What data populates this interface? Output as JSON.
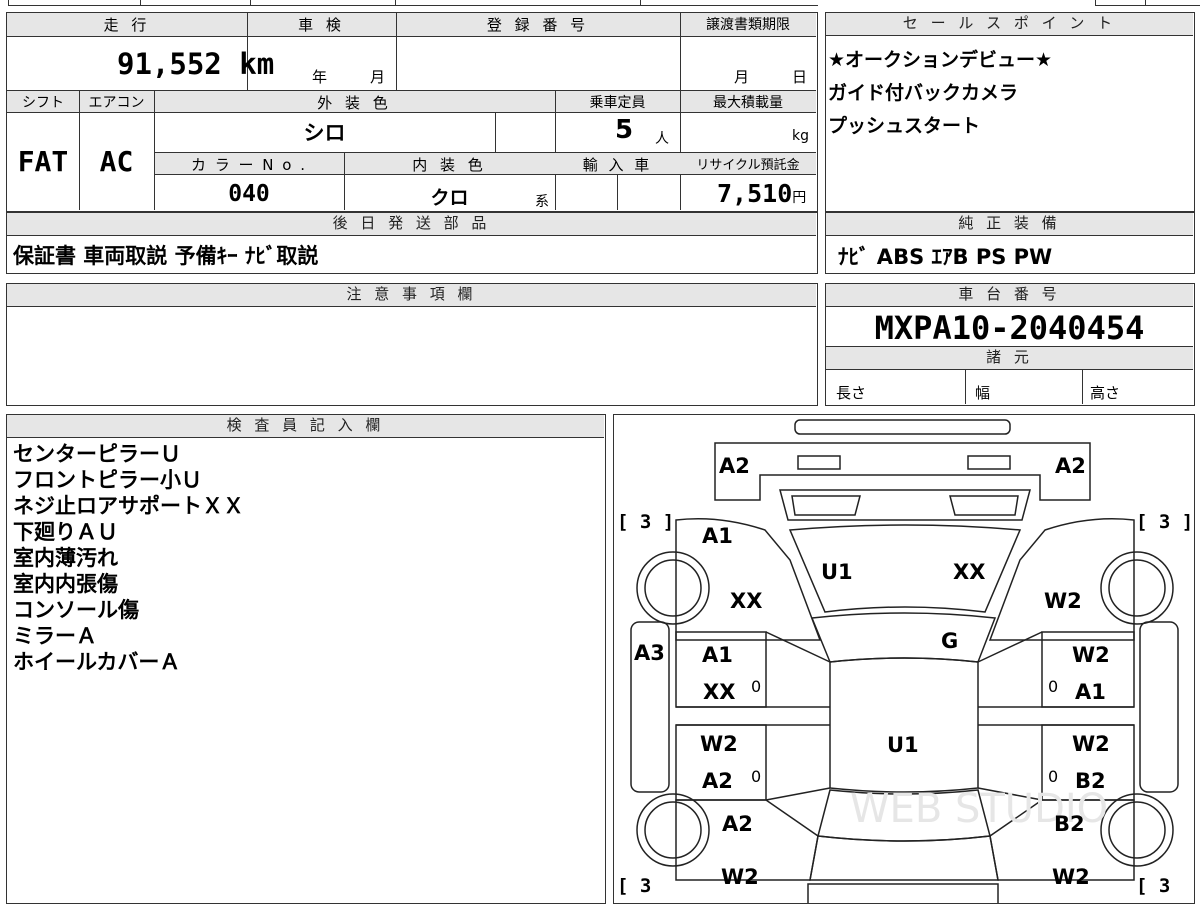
{
  "vehicle": {
    "mileage_header": "走 行",
    "mileage": "91,552",
    "mileage_unit": "km",
    "inspection_header": "車 検",
    "inspection_year": "年",
    "inspection_month": "月",
    "registration_header": "登 録 番 号",
    "transfer_header": "譲渡書類期限",
    "transfer_month": "月",
    "transfer_day": "日",
    "shift_header": "シフト",
    "shift": "FAT",
    "ac_header": "エアコン",
    "ac": "AC",
    "exterior_header": "外 装 色",
    "exterior_color": "シロ",
    "capacity_header": "乗車定員",
    "capacity": "5",
    "capacity_unit": "人",
    "max_load_header": "最大積載量",
    "max_load_unit": "kg",
    "color_no_header": "カ ラ ー N o .",
    "color_no": "040",
    "interior_header": "内 装 色",
    "interior_color": "クロ",
    "interior_suffix": "系",
    "import_header": "輸 入 車",
    "recycle_header": "リサイクル預託金",
    "recycle_fee": "7,510",
    "recycle_unit": "円"
  },
  "sales_points": {
    "header": "セ ー ル ス ポ イ ン ト",
    "lines": [
      "★オークションデビュー★",
      "ガイド付バックカメラ",
      "プッシュスタート"
    ]
  },
  "later_parts": {
    "header": "後 日 発 送 部 品",
    "text": "保証書 車両取説 予備ｷｰ ﾅﾋﾞ取説"
  },
  "genuine_equipment": {
    "header": "純 正 装 備",
    "text": "ﾅﾋﾞ ABS ｴｱB PS PW"
  },
  "notes": {
    "header": "注 意 事 項 欄"
  },
  "chassis": {
    "header": "車 台 番 号",
    "number": "MXPA10-2040454",
    "spec_header": "諸 元",
    "length_label": "長さ",
    "width_label": "幅",
    "height_label": "高さ"
  },
  "inspector": {
    "header": "検 査 員 記 入 欄",
    "lines": [
      "センターピラーＵ",
      "フロントピラー小Ｕ",
      "ネジ止ロアサポートＸＸ",
      "下廻りＡＵ",
      "室内薄汚れ",
      "室内内張傷",
      "コンソール傷",
      "ミラーＡ",
      "ホイールカバーＡ"
    ]
  },
  "diagram": {
    "front_left": "A2",
    "front_right": "A2",
    "fender_fl": "A1",
    "fender_fl2": "XX",
    "hood_left": "U1",
    "hood_right": "XX",
    "fender_fr": "W2",
    "windshield": "G",
    "left_side": "A3",
    "door_fl": "A1",
    "door_fl2": "XX",
    "door_fr": "W2",
    "door_fr2": "A1",
    "roof": "U1",
    "door_rl": "W2",
    "door_rl2": "A2",
    "door_rr": "W2",
    "door_rr2": "B2",
    "rear_left": "A2",
    "rear_right": "B2",
    "bottom_left": "W2",
    "bottom_right": "W2",
    "tire_fl": "[ 3 ]",
    "tire_fr": "[ 3 ]",
    "tire_rl": "[ 3",
    "tire_rr": "[ 3",
    "zero_mark": "0",
    "watermark": "WEB STUDIO"
  }
}
